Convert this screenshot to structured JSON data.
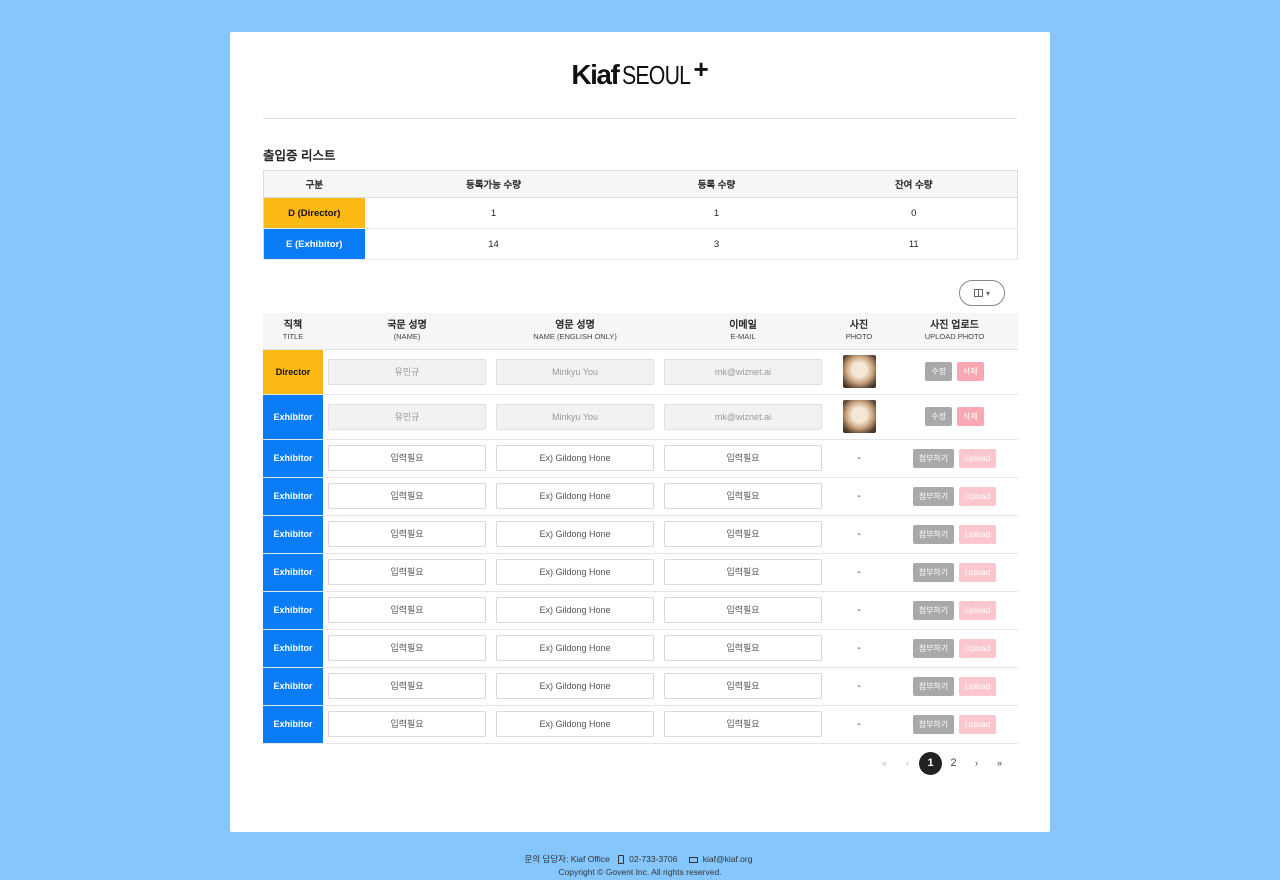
{
  "logo": {
    "kiaf": "Kiaf",
    "seoul": "SEOUL",
    "plus": "+"
  },
  "section_title": "출입증 리스트",
  "summary": {
    "headers": [
      "구분",
      "등록가능 수량",
      "등록 수량",
      "잔여 수량"
    ],
    "rows": [
      {
        "category": "D (Director)",
        "available": "1",
        "registered": "1",
        "remaining": "0",
        "color": "#fdb913"
      },
      {
        "category": "E (Exhibitor)",
        "available": "14",
        "registered": "3",
        "remaining": "11",
        "color": "#0a7cf6"
      }
    ]
  },
  "view_toggle_icon": "columns-icon",
  "list": {
    "headers": [
      {
        "ko": "직책",
        "en": "TITLE"
      },
      {
        "ko": "국문 성명",
        "en": "(NAME)"
      },
      {
        "ko": "영문 성명",
        "en": "NAME (ENGLISH ONLY)"
      },
      {
        "ko": "이메일",
        "en": "E-MAIL"
      },
      {
        "ko": "사진",
        "en": "PHOTO"
      },
      {
        "ko": "사진 업로드",
        "en": "UPLOAD PHOTO"
      }
    ],
    "filled_rows": [
      {
        "role": "Director",
        "name_ko": "유민규",
        "name_en": "Minkyu You",
        "email": "mk@wiznet.ai",
        "edit": "수정",
        "delete": "삭제"
      },
      {
        "role": "Exhibitor",
        "name_ko": "유민규",
        "name_en": "Minkyu You",
        "email": "mk@wiznet.ai",
        "edit": "수정",
        "delete": "삭제"
      }
    ],
    "empty_rows": [
      {
        "role": "Exhibitor",
        "name_ko": "입력필요",
        "name_en": "Ex) Gildong Hone",
        "email": "입력필요",
        "photo": "-",
        "attach": "첨부하기",
        "upload": "Upload"
      },
      {
        "role": "Exhibitor",
        "name_ko": "입력필요",
        "name_en": "Ex) Gildong Hone",
        "email": "입력필요",
        "photo": "-",
        "attach": "첨부하기",
        "upload": "Upload"
      },
      {
        "role": "Exhibitor",
        "name_ko": "입력필요",
        "name_en": "Ex) Gildong Hone",
        "email": "입력필요",
        "photo": "-",
        "attach": "첨부하기",
        "upload": "Upload"
      },
      {
        "role": "Exhibitor",
        "name_ko": "입력필요",
        "name_en": "Ex) Gildong Hone",
        "email": "입력필요",
        "photo": "-",
        "attach": "첨부하기",
        "upload": "Upload"
      },
      {
        "role": "Exhibitor",
        "name_ko": "입력필요",
        "name_en": "Ex) Gildong Hone",
        "email": "입력필요",
        "photo": "-",
        "attach": "첨부하기",
        "upload": "Upload"
      },
      {
        "role": "Exhibitor",
        "name_ko": "입력필요",
        "name_en": "Ex) Gildong Hone",
        "email": "입력필요",
        "photo": "-",
        "attach": "첨부하기",
        "upload": "Upload"
      },
      {
        "role": "Exhibitor",
        "name_ko": "입력필요",
        "name_en": "Ex) Gildong Hone",
        "email": "입력필요",
        "photo": "-",
        "attach": "첨부하기",
        "upload": "Upload"
      },
      {
        "role": "Exhibitor",
        "name_ko": "입력필요",
        "name_en": "Ex) Gildong Hone",
        "email": "입력필요",
        "photo": "-",
        "attach": "첨부하기",
        "upload": "Upload"
      }
    ]
  },
  "pagination": {
    "first": "«",
    "prev": "‹",
    "pages": [
      "1",
      "2"
    ],
    "current": "1",
    "next": "›",
    "last": "»"
  },
  "footer": {
    "contact": "문의 담당자: Kiaf Office",
    "phone": "02-733-3706",
    "email": "kiaf@kiaf.org",
    "copyright": "Copyright © Govent Inc. All rights reserved."
  },
  "colors": {
    "background": "#85c6fc",
    "director": "#fdb913",
    "exhibitor": "#0a7cf6"
  }
}
